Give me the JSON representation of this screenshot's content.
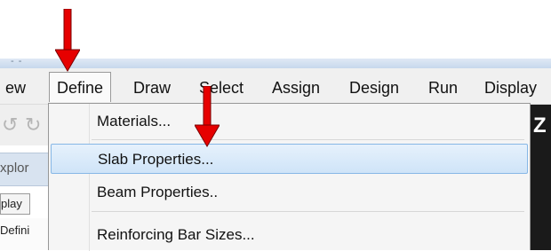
{
  "menubar": {
    "items": [
      {
        "id": "view",
        "label": "ew"
      },
      {
        "id": "define",
        "label": "Define"
      },
      {
        "id": "draw",
        "label": "Draw"
      },
      {
        "id": "select",
        "label": "Select"
      },
      {
        "id": "assign",
        "label": "Assign"
      },
      {
        "id": "design",
        "label": "Design"
      },
      {
        "id": "run",
        "label": "Run"
      },
      {
        "id": "display",
        "label": "Display"
      }
    ]
  },
  "define_menu": {
    "items": [
      {
        "label": "Materials..."
      },
      {
        "label": "Slab Properties...",
        "highlighted": true
      },
      {
        "label": "Beam Properties.."
      },
      {
        "label": "Reinforcing Bar Sizes..."
      }
    ]
  },
  "background": {
    "explorer_title": "xplor",
    "tab_label": "play",
    "tree_item": "Defini",
    "toolbar_right_glyph": "Z"
  },
  "colors": {
    "arrow": "#e60000",
    "highlight": "#cfe4f8",
    "menu_bg": "#f5f5f5"
  }
}
